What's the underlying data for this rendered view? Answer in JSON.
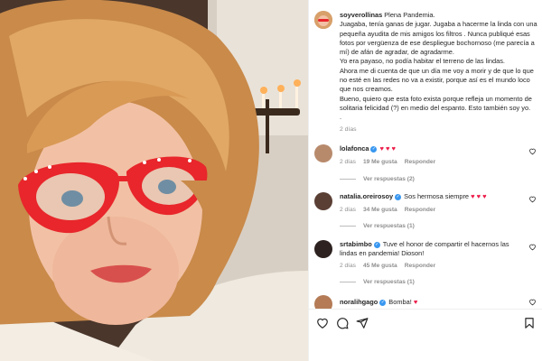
{
  "post": {
    "author": "soyverollinas",
    "caption_lines": [
      "Plena Pandemia.",
      "Juagaba, tenía ganas de jugar. Jugaba a hacerme la linda con una pequeña ayudita de mis amigos los filtros . Nunca publiqué esas fotos por vergüenza de ese despliegue bochornoso (me parecía a mí) de afán de agradar, de agradarme.",
      "Yo era payaso, no podía habitar el terreno de las lindas.",
      "Ahora me di cuenta de que un día me voy a morir y de que lo que no esté en las redes no va a existir, porque así es el mundo loco que nos creamos.",
      "Bueno, quiero que esta foto exista porque refleja un momento de solitaria felicidad (?) en medio del espanto. Esto también soy yo.",
      "."
    ],
    "time": "2 días"
  },
  "comments": [
    {
      "user": "lolafonca",
      "verified": true,
      "text": "",
      "hearts": "♥ ♥ ♥",
      "time": "2 días",
      "likes": "19 Me gusta",
      "reply": "Responder",
      "view_replies": "Ver respuestas (2)"
    },
    {
      "user": "natalia.oreirosoy",
      "verified": true,
      "text": "Sos hermosa siempre",
      "hearts": "♥ ♥ ♥",
      "time": "2 días",
      "likes": "34 Me gusta",
      "reply": "Responder",
      "view_replies": "Ver respuestas (1)"
    },
    {
      "user": "srtabimbo",
      "verified": true,
      "text": "Tuve el honor de compartir el hacernos las lindas en pandemia! Dioson!",
      "hearts": "",
      "time": "2 días",
      "likes": "45 Me gusta",
      "reply": "Responder",
      "view_replies": "Ver respuestas (1)"
    },
    {
      "user": "noralihgago",
      "verified": true,
      "text": "Bomba!",
      "hearts": "♥",
      "time": "",
      "likes": "",
      "reply": "",
      "view_replies": ""
    }
  ],
  "icons": {
    "like": "heart-outline-icon",
    "comment": "speech-bubble-icon",
    "share": "paper-plane-icon",
    "save": "bookmark-icon",
    "verified": "verified-badge-icon",
    "comment_like": "small-heart-icon"
  },
  "colors": {
    "accent_red": "#ed1c4a",
    "verified_blue": "#3897f0",
    "meta_gray": "#8e8e8e",
    "glasses_red": "#e8262b"
  }
}
